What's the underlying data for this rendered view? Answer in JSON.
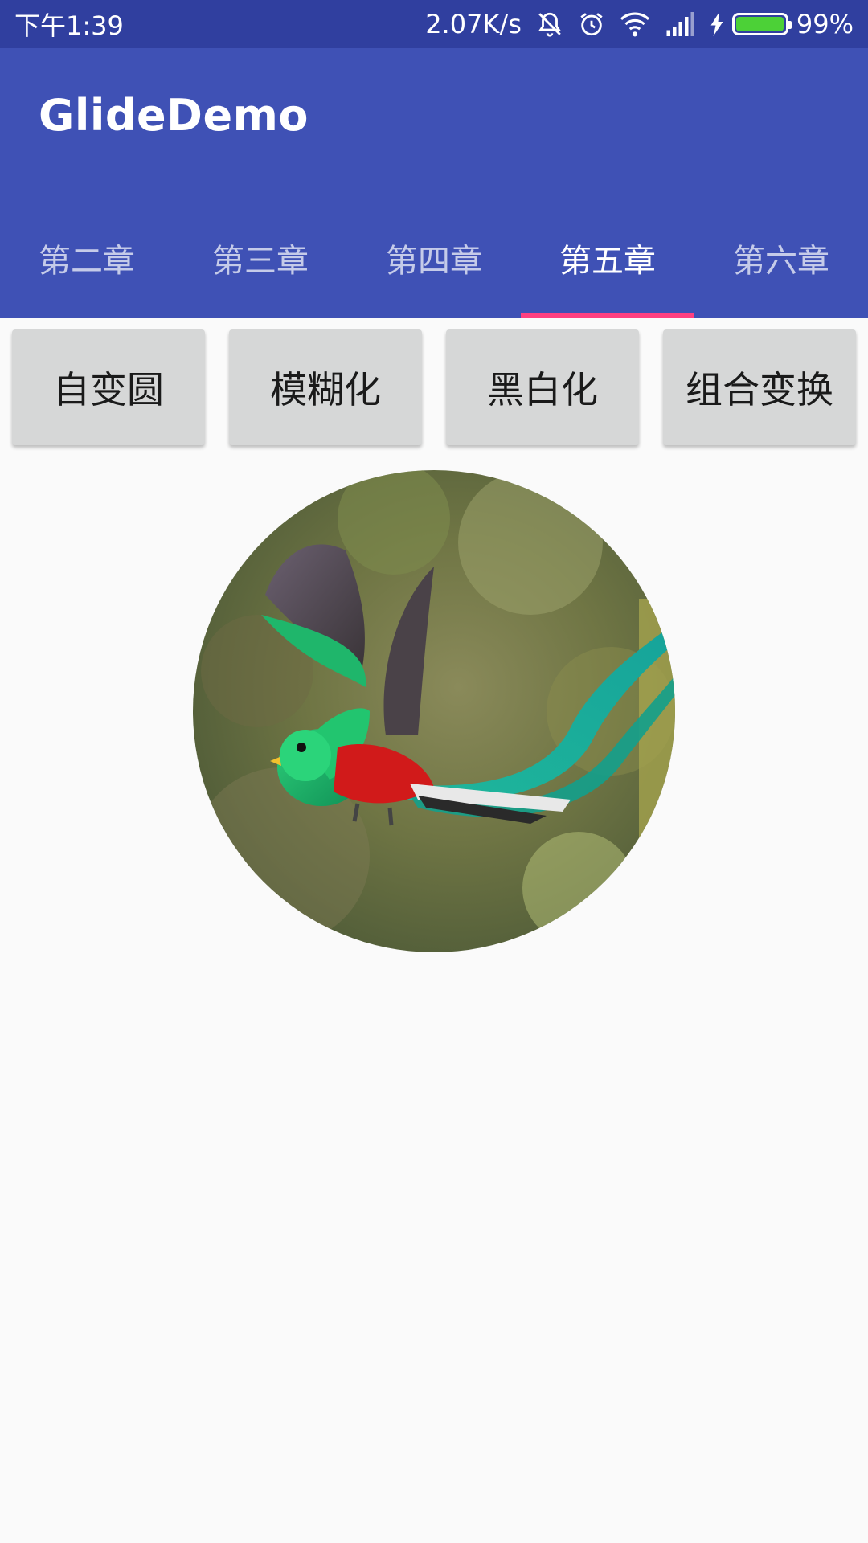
{
  "status_bar": {
    "time": "下午1:39",
    "speed": "2.07K/s",
    "battery_percent": "99%",
    "battery_level": 0.99,
    "icons": [
      "mute-icon",
      "alarm-icon",
      "wifi-icon",
      "signal-icon",
      "charging-icon",
      "battery-icon"
    ]
  },
  "app_bar": {
    "title": "GlideDemo"
  },
  "tabs": [
    {
      "label": "第二章",
      "selected": false
    },
    {
      "label": "第三章",
      "selected": false
    },
    {
      "label": "第四章",
      "selected": false
    },
    {
      "label": "第五章",
      "selected": true
    },
    {
      "label": "第六章",
      "selected": false
    }
  ],
  "buttons": [
    {
      "label": "自变圆"
    },
    {
      "label": "模糊化"
    },
    {
      "label": "黑白化"
    },
    {
      "label": "组合变换"
    }
  ],
  "colors": {
    "status_bar": "#303F9F",
    "app_bar": "#3F51B5",
    "tab_indicator": "#FF4081",
    "button_bg": "#D6D7D7",
    "background": "#FAFAFA"
  }
}
